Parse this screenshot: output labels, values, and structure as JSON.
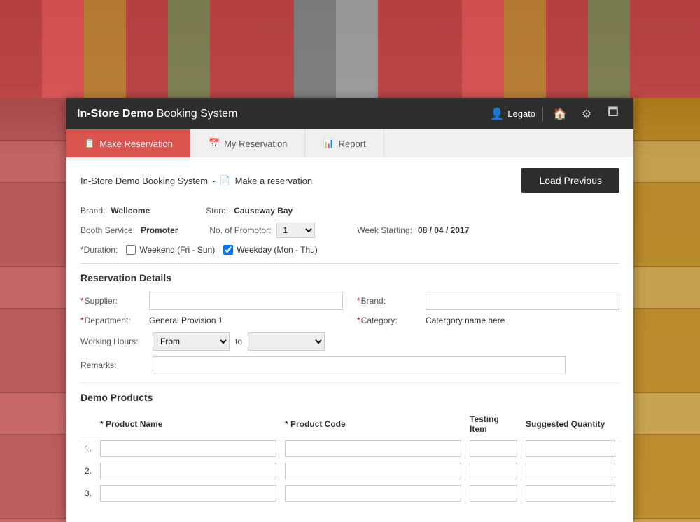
{
  "header": {
    "title_bold": "In-Store Demo",
    "title_normal": " Booking System",
    "username": "Legato"
  },
  "tabs": [
    {
      "id": "make-reservation",
      "label": "Make Reservation",
      "active": true,
      "icon": "form-icon"
    },
    {
      "id": "my-reservation",
      "label": "My Reservation",
      "active": false,
      "icon": "calendar-icon"
    },
    {
      "id": "report",
      "label": "Report",
      "active": false,
      "icon": "chart-icon"
    }
  ],
  "breadcrumb": {
    "system": "In-Store Demo Booking System",
    "separator": "-",
    "page": "Make a reservation"
  },
  "load_previous_button": "Load Previous",
  "form": {
    "brand_label": "Brand:",
    "brand_value": "Wellcome",
    "store_label": "Store:",
    "store_value": "Causeway Bay",
    "booth_service_label": "Booth Service:",
    "booth_service_value": "Promoter",
    "no_of_promotor_label": "No. of Promotor:",
    "no_of_promotor_value": "1",
    "week_starting_label": "Week Starting:",
    "week_starting_value": "08 / 04 / 2017",
    "duration_label": "*Duration:",
    "duration_options": [
      {
        "label": "Weekend (Fri - Sun)",
        "checked": false
      },
      {
        "label": "Weekday (Mon - Thu)",
        "checked": true
      }
    ]
  },
  "reservation_details": {
    "section_title": "Reservation Details",
    "supplier_label": "*Supplier:",
    "supplier_value": "",
    "brand_label": "*Brand:",
    "brand_value": "",
    "department_label": "*Department:",
    "department_value": "General Provision 1",
    "category_label": "*Category:",
    "category_value": "Catergory name here",
    "working_hours_label": "Working Hours:",
    "from_label": "From",
    "to_label": "to",
    "remarks_label": "Remarks:"
  },
  "demo_products": {
    "section_title": "Demo Products",
    "columns": [
      {
        "label": "* Product Name"
      },
      {
        "label": "* Product Code"
      },
      {
        "label": "Testing Item"
      },
      {
        "label": "Suggested Quantity"
      }
    ],
    "rows": [
      {
        "num": "1."
      },
      {
        "num": "2."
      },
      {
        "num": "3."
      }
    ]
  }
}
